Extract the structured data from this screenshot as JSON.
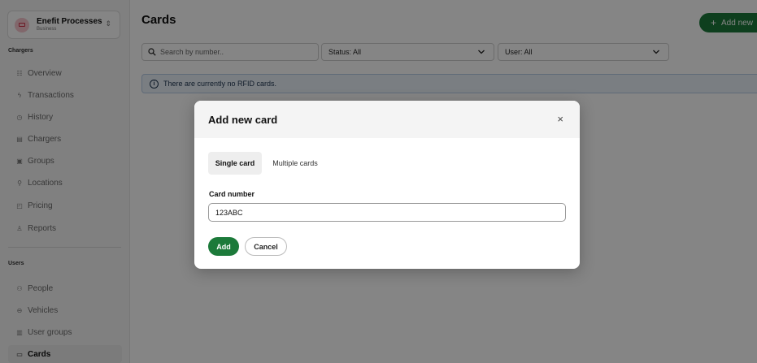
{
  "org": {
    "name": "Enefit Processes",
    "sub": "Business",
    "logo_icon": "building-icon",
    "switch_icon": "chevron-up-down-icon"
  },
  "sidebar": {
    "sections": [
      {
        "title": "Chargers"
      },
      {
        "title": "Users"
      }
    ],
    "items": [
      {
        "label": "Overview",
        "icon": "grid-icon",
        "glyph": "☷"
      },
      {
        "label": "Transactions",
        "icon": "bolt-icon",
        "glyph": "ϟ"
      },
      {
        "label": "History",
        "icon": "clock-icon",
        "glyph": "◷"
      },
      {
        "label": "Chargers",
        "icon": "charger-icon",
        "glyph": "▤"
      },
      {
        "label": "Groups",
        "icon": "groups-icon",
        "glyph": "▣"
      },
      {
        "label": "Locations",
        "icon": "location-pin-icon",
        "glyph": "⚲"
      },
      {
        "label": "Pricing",
        "icon": "pricing-tag-icon",
        "glyph": "◰"
      },
      {
        "label": "Reports",
        "icon": "reports-icon",
        "glyph": "♙"
      },
      {
        "label": "People",
        "icon": "people-icon",
        "glyph": "⚇"
      },
      {
        "label": "Vehicles",
        "icon": "vehicle-icon",
        "glyph": "⊖"
      },
      {
        "label": "User groups",
        "icon": "user-groups-icon",
        "glyph": "▥"
      },
      {
        "label": "Cards",
        "icon": "card-icon",
        "glyph": "▭"
      }
    ]
  },
  "header": {
    "title": "Cards",
    "add_new_label": "Add new"
  },
  "filters": {
    "search_placeholder": "Search by number..",
    "status_label": "Status: All",
    "user_label": "User: All"
  },
  "info_banner": {
    "text": "There are currently no RFID cards."
  },
  "modal": {
    "title": "Add new card",
    "close_glyph": "×",
    "tabs": [
      {
        "label": "Single card",
        "active": true
      },
      {
        "label": "Multiple cards",
        "active": false
      }
    ],
    "field_label": "Card number",
    "field_value": "123ABC",
    "add_label": "Add",
    "cancel_label": "Cancel"
  },
  "colors": {
    "primary": "#1c7a3a",
    "info_bg": "#eaf1f9",
    "overlay": "rgba(0,0,0,0.48)"
  }
}
